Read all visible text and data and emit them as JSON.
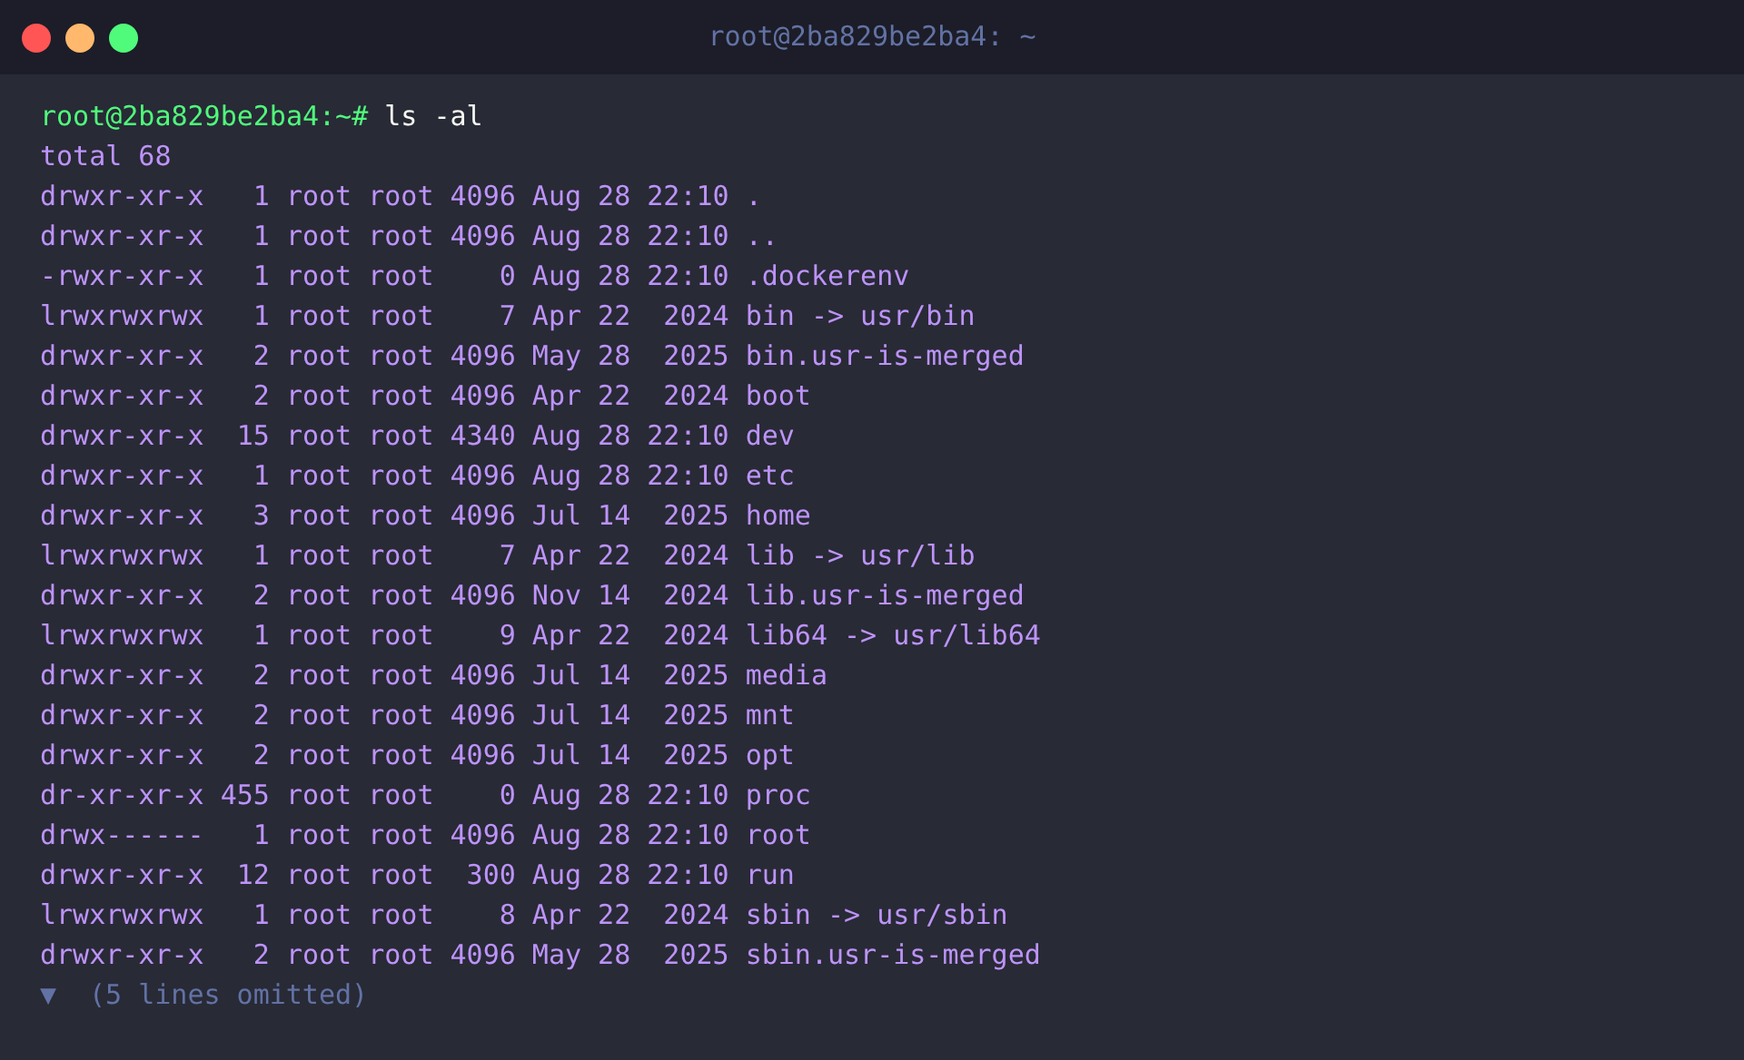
{
  "window": {
    "title": "root@2ba829be2ba4: ~"
  },
  "prompt": {
    "text": "root@2ba829be2ba4:~#",
    "command": "ls -al"
  },
  "output": [
    "total 68",
    "drwxr-xr-x   1 root root 4096 Aug 28 22:10 .",
    "drwxr-xr-x   1 root root 4096 Aug 28 22:10 ..",
    "-rwxr-xr-x   1 root root    0 Aug 28 22:10 .dockerenv",
    "lrwxrwxrwx   1 root root    7 Apr 22  2024 bin -> usr/bin",
    "drwxr-xr-x   2 root root 4096 May 28  2025 bin.usr-is-merged",
    "drwxr-xr-x   2 root root 4096 Apr 22  2024 boot",
    "drwxr-xr-x  15 root root 4340 Aug 28 22:10 dev",
    "drwxr-xr-x   1 root root 4096 Aug 28 22:10 etc",
    "drwxr-xr-x   3 root root 4096 Jul 14  2025 home",
    "lrwxrwxrwx   1 root root    7 Apr 22  2024 lib -> usr/lib",
    "drwxr-xr-x   2 root root 4096 Nov 14  2024 lib.usr-is-merged",
    "lrwxrwxrwx   1 root root    9 Apr 22  2024 lib64 -> usr/lib64",
    "drwxr-xr-x   2 root root 4096 Jul 14  2025 media",
    "drwxr-xr-x   2 root root 4096 Jul 14  2025 mnt",
    "drwxr-xr-x   2 root root 4096 Jul 14  2025 opt",
    "dr-xr-xr-x 455 root root    0 Aug 28 22:10 proc",
    "drwx------   1 root root 4096 Aug 28 22:10 root",
    "drwxr-xr-x  12 root root  300 Aug 28 22:10 run",
    "lrwxrwxrwx   1 root root    8 Apr 22  2024 sbin -> usr/sbin",
    "drwxr-xr-x   2 root root 4096 May 28  2025 sbin.usr-is-merged"
  ],
  "omitted": {
    "toggle": "▼",
    "text": "(5 lines omitted)"
  }
}
